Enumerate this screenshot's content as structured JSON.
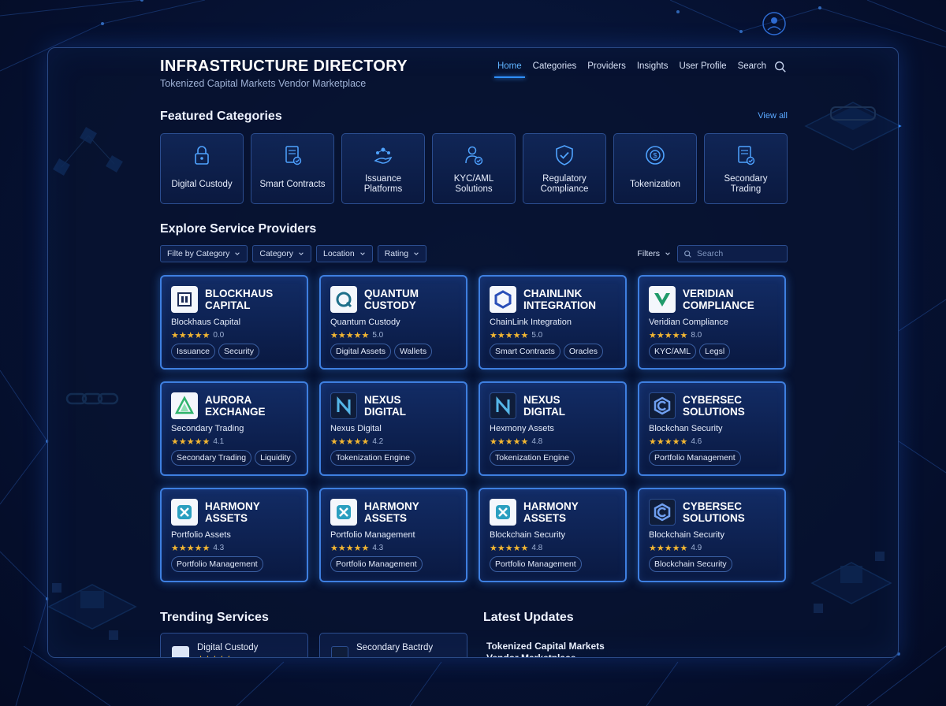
{
  "header": {
    "title": "INFRASTRUCTURE DIRECTORY",
    "subtitle": "Tokenized Capital Markets Vendor Marketplace"
  },
  "nav": {
    "items": [
      "Home",
      "Categories",
      "Providers",
      "Insights",
      "User Profile",
      "Search"
    ],
    "active": "Home"
  },
  "featured": {
    "title": "Featured Categories",
    "view_all": "View all",
    "categories": [
      {
        "label": "Digital Custody",
        "icon": "lock-icon"
      },
      {
        "label": "Smart Contracts",
        "icon": "contract-icon"
      },
      {
        "label": "Issuance\nPlatforms",
        "icon": "network-hand-icon"
      },
      {
        "label": "KYC/AML\nSolutions",
        "icon": "person-check-icon"
      },
      {
        "label": "Regulatory\nCompliance",
        "icon": "shield-check-icon"
      },
      {
        "label": "Tokenization",
        "icon": "coin-cycle-icon"
      },
      {
        "label": "Secondary\nTrading",
        "icon": "document-check-icon"
      }
    ]
  },
  "providers": {
    "title": "Explore Service Providers",
    "filters": [
      "Filte by Category",
      "Category",
      "Location",
      "Rating"
    ],
    "filters_label": "Filters",
    "search_placeholder": "Search",
    "cards": [
      {
        "name": "BLOCKHAUS\nCAPITAL",
        "subtitle": "Blockhaus Capital",
        "rating": "0.0",
        "stars": "★★★★★",
        "tags": [
          "Issuance",
          "Security"
        ],
        "logo": "blockhaus-logo-icon"
      },
      {
        "name": "QUANTUM\nCUSTODY",
        "subtitle": "Quantum Custody",
        "rating": "5.0",
        "stars": "★★★★★",
        "tags": [
          "Digital Assets",
          "Wallets"
        ],
        "logo": "quantum-logo-icon"
      },
      {
        "name": "CHAINLINK\nINTEGRATION",
        "subtitle": "ChainLink Integration",
        "rating": "5.0",
        "stars": "★★★★★",
        "tags": [
          "Smart Contracts",
          "Oracles"
        ],
        "logo": "chainlink-logo-icon"
      },
      {
        "name": "VERIDIAN\nCOMPLIANCE",
        "subtitle": "Veridian Compliance",
        "rating": "8.0",
        "stars": "★★★★★",
        "tags": [
          "KYC/AML",
          "Legsl"
        ],
        "logo": "veridian-logo-icon"
      },
      {
        "name": "AURORA\nEXCHANGE",
        "subtitle": "Secondary Trading",
        "rating": "4.1",
        "stars": "★★★★★",
        "tags": [
          "Secondary Trading",
          "Liquidity"
        ],
        "logo": "aurora-logo-icon"
      },
      {
        "name": "NEXUS\nDIGITAL",
        "subtitle": "Nexus Digital",
        "rating": "4.2",
        "stars": "★★★★★",
        "tags": [
          "Tokenization Engine"
        ],
        "logo": "nexus-logo-icon"
      },
      {
        "name": "NEXUS\nDIGITAL",
        "subtitle": "Hexmony Assets",
        "rating": "4.8",
        "stars": "★★★★★",
        "tags": [
          "Tokenization Engine"
        ],
        "logo": "nexus-logo-icon"
      },
      {
        "name": "CYBERSEC\nSOLUTIONS",
        "subtitle": "Blockchan Security",
        "rating": "4.6",
        "stars": "★★★★★",
        "tags": [
          "Portfolio Management"
        ],
        "logo": "cybersec-logo-icon"
      },
      {
        "name": "HARMONY\nASSETS",
        "subtitle": "Portfolio Assets",
        "rating": "4.3",
        "stars": "★★★★★",
        "tags": [
          "Portfolio Management"
        ],
        "logo": "harmony-logo-icon"
      },
      {
        "name": "HARMONY\nASSETS",
        "subtitle": "Portfolio Management",
        "rating": "4.3",
        "stars": "★★★★★",
        "tags": [
          "Portfolio Management"
        ],
        "logo": "harmony-logo-icon"
      },
      {
        "name": "HARMONY\nASSETS",
        "subtitle": "Blockchain Security",
        "rating": "4.8",
        "stars": "★★★★★",
        "tags": [
          "Portfolio Management"
        ],
        "logo": "harmony-logo-icon"
      },
      {
        "name": "CYBERSEC\nSOLUTIONS",
        "subtitle": "Blockchain Security",
        "rating": "4.9",
        "stars": "★★★★★",
        "tags": [
          "Blockchain Security"
        ],
        "logo": "cybersec-logo-icon"
      }
    ]
  },
  "trending": {
    "title": "Trending Services",
    "items": [
      {
        "name": "Digital Custody",
        "stars": "★★★★★"
      },
      {
        "name": "Secondary Bactrdy",
        "stars": ""
      }
    ]
  },
  "updates": {
    "title": "Latest Updates",
    "items": [
      "Tokenized Capital Markets\nVendor Marketplace"
    ]
  },
  "colors": {
    "accent": "#2f8fff",
    "background": "#061233",
    "star": "#f2b632"
  }
}
